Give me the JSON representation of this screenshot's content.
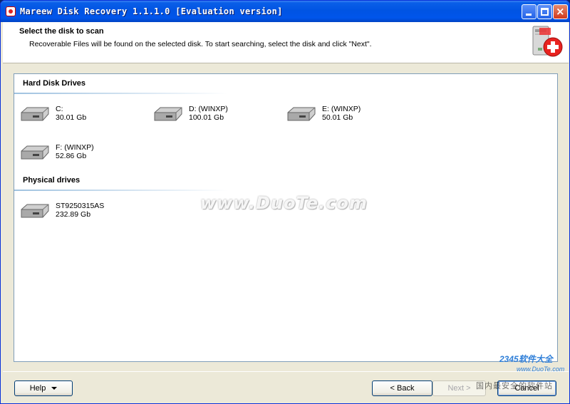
{
  "window": {
    "title": "Mareew Disk Recovery 1.1.1.0 [Evaluation version]",
    "controls": {
      "minimize": "minimize",
      "maximize": "maximize",
      "close": "×"
    }
  },
  "header": {
    "title": "Select the disk to scan",
    "subtitle": "Recoverable Files will be found on the selected disk. To start searching, select the disk and click \"Next\"."
  },
  "sections": {
    "hard_disk": {
      "title": "Hard Disk Drives",
      "drives": [
        {
          "name": "C:",
          "size": "30.01 Gb"
        },
        {
          "name": "D: (WINXP)",
          "size": "100.01 Gb"
        },
        {
          "name": "E: (WINXP)",
          "size": "50.01 Gb"
        },
        {
          "name": "F: (WINXP)",
          "size": "52.86 Gb"
        }
      ]
    },
    "physical": {
      "title": "Physical drives",
      "drives": [
        {
          "name": "ST9250315AS",
          "size": "232.89 Gb"
        }
      ]
    }
  },
  "buttons": {
    "help": "Help",
    "back": "< Back",
    "next": "Next >",
    "cancel": "Cancel"
  },
  "watermarks": {
    "center": "www.DuoTe.com",
    "corner_brand": "2345软件大全",
    "corner_url": "www.DuoTe.com",
    "corner_cn": "国内最安全的软件站"
  },
  "colors": {
    "titlebar": "#0054e3",
    "window_bg": "#ece9d8",
    "accent_line": "#9fc2e0"
  },
  "icons": {
    "app": "app-logo-icon",
    "header": "disk-recovery-plus-icon",
    "drive": "hard-drive-icon"
  }
}
